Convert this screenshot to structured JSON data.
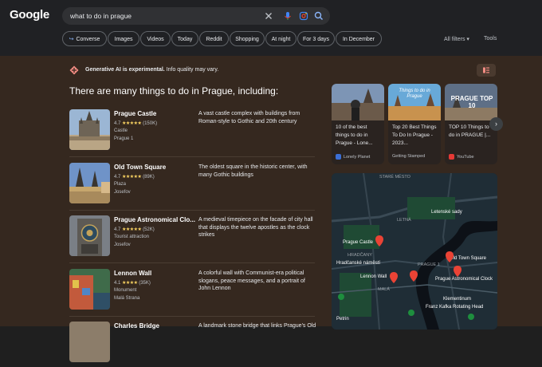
{
  "header": {
    "logo": "Google",
    "query": "what to do in prague",
    "chips": [
      {
        "label": "Converse"
      },
      {
        "label": "Images"
      },
      {
        "label": "Videos"
      },
      {
        "label": "Today"
      },
      {
        "label": "Reddit"
      },
      {
        "label": "Shopping"
      },
      {
        "label": "At night"
      },
      {
        "label": "For 3 days"
      },
      {
        "label": "In December"
      }
    ],
    "all_filters": "All filters",
    "tools": "Tools"
  },
  "ai": {
    "label_bold": "Generative AI is experimental.",
    "label_rest": "Info quality may vary.",
    "heading": "There are many things to do in Prague, including:"
  },
  "items": [
    {
      "name": "Prague Castle",
      "rating": "4.7",
      "reviews": "(150K)",
      "type": "Castle",
      "area": "Prague 1",
      "desc": "A vast castle complex with buildings from Roman-style to Gothic and 20th century"
    },
    {
      "name": "Old Town Square",
      "rating": "4.7",
      "reviews": "(89K)",
      "type": "Plaza",
      "area": "Josefov",
      "desc": "The oldest square in the historic center, with many Gothic buildings"
    },
    {
      "name": "Prague Astronomical Clo...",
      "rating": "4.7",
      "reviews": "(52K)",
      "type": "Tourist attraction",
      "area": "Josefov",
      "desc": "A medieval timepiece on the facade of city hall that displays the twelve apostles as the clock strikes"
    },
    {
      "name": "Lennon Wall",
      "rating": "4.1",
      "reviews": "(35K)",
      "type": "Monument",
      "area": "Malá Strana",
      "desc": "A colorful wall with Communist-era political slogans, peace messages, and a portrait of John Lennon"
    },
    {
      "name": "Charles Bridge",
      "rating": "",
      "reviews": "",
      "type": "",
      "area": "",
      "desc": "A landmark stone bridge that links Prague's Old"
    }
  ],
  "cards": [
    {
      "title": "10 of the best things to do in Prague - Lone...",
      "source": "Lonely Planet",
      "overlay": "",
      "color": "#3b6fd6"
    },
    {
      "title": "Top 20 Best Things To Do In Prague - 2023...",
      "source": "Getting Stamped",
      "overlay": "Things to do in Prague",
      "color": "#2f8f6a"
    },
    {
      "title": "TOP 10 Things to do in PRAGUE |...",
      "source": "YouTube",
      "overlay": "PRAGUE TOP 10",
      "color": "#e53935"
    }
  ],
  "map": {
    "labels": {
      "stare_mesto": "STARÉ MĚSTO",
      "letna": "LETNÁ",
      "letenske": "Letenské sady",
      "castle": "Prague Castle",
      "hrad": "HRADČANY",
      "hradcanske": "Hradčanské náměstí",
      "prague1": "PRAGUE 1",
      "oldtown": "Old Town Square",
      "clock": "Prague Astronomical Clock",
      "lennon": "Lennon Wall",
      "franz": "Franz Kafka Rotating Head",
      "mala": "MALÁ",
      "klementinum": "Klementinum",
      "petrin": "Petrin"
    }
  },
  "colors": {
    "accent": "#8ab4f8",
    "star": "#fdd663",
    "pin": "#ea4335",
    "ai_icon": "#f28b82"
  }
}
